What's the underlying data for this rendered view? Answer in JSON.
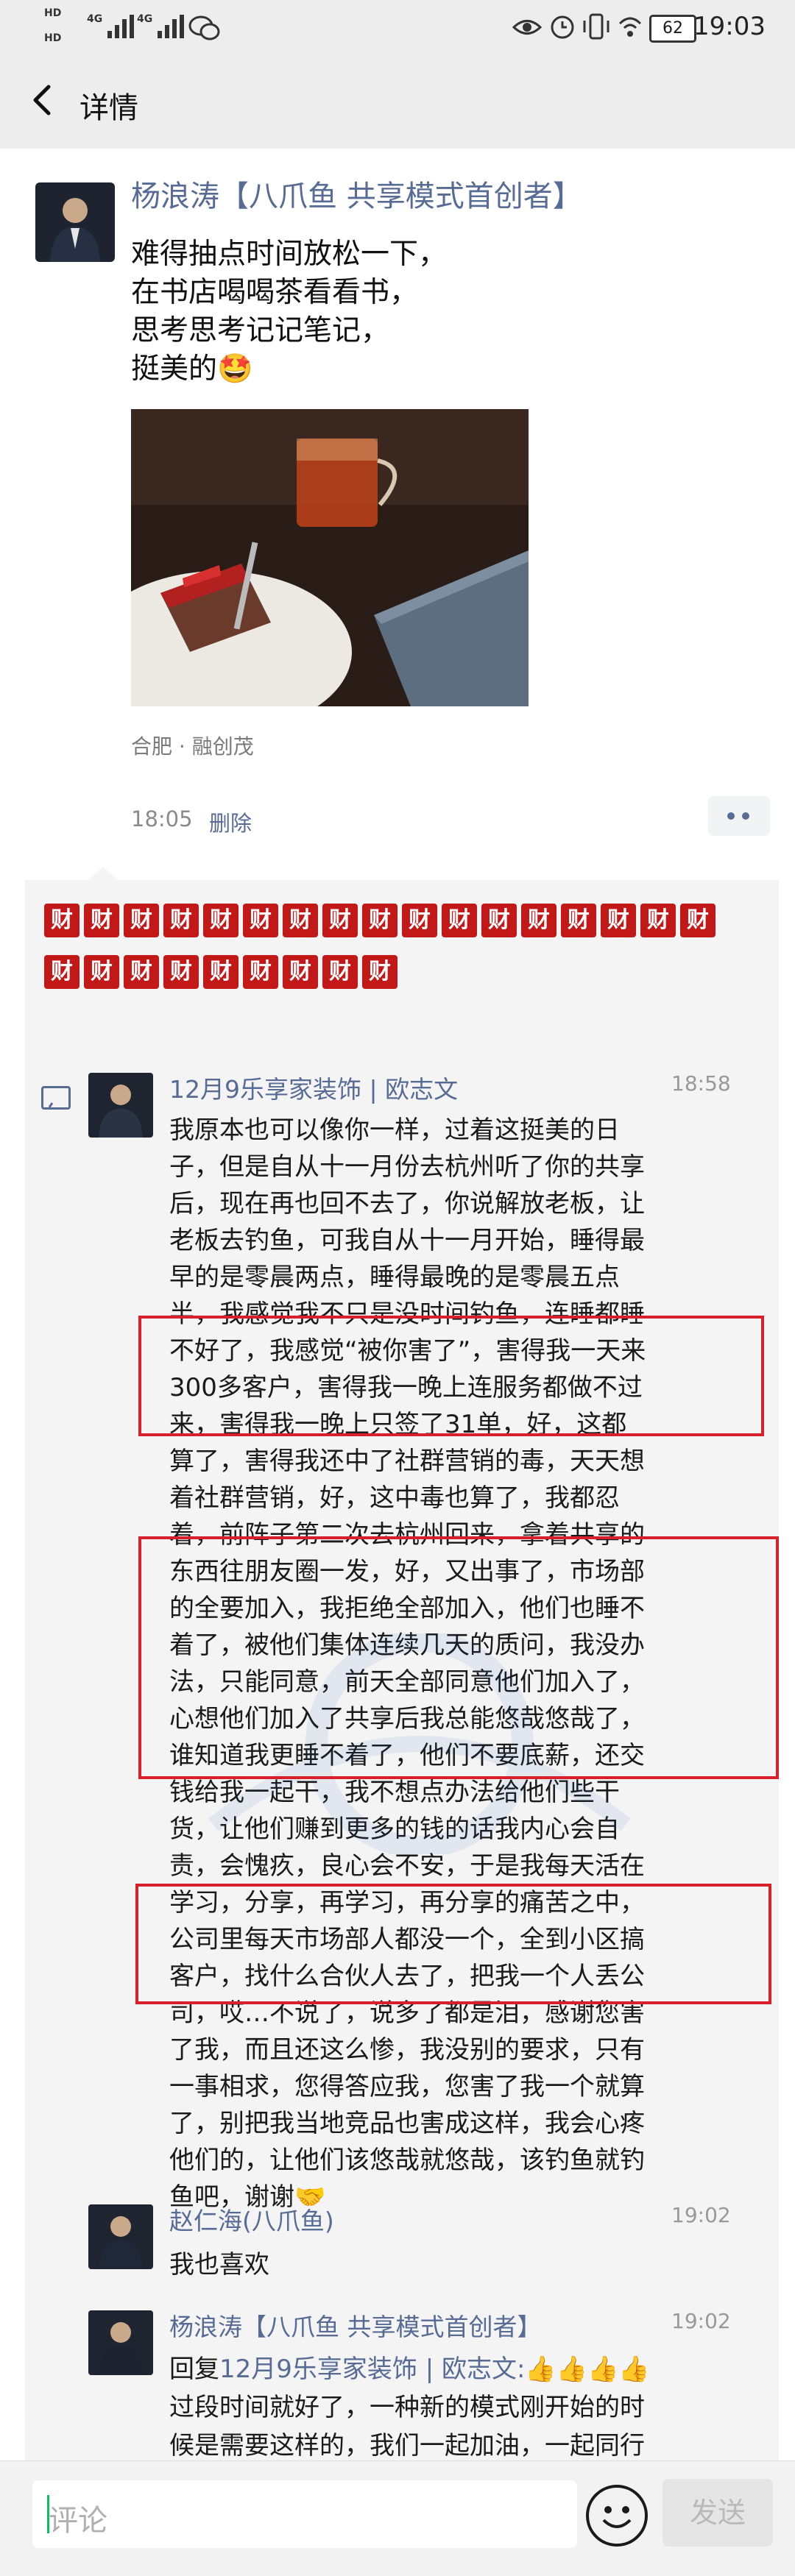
{
  "status_bar": {
    "hd1": "HD",
    "hd2": "HD",
    "sig1": "4G",
    "sig2": "4G",
    "battery": "62",
    "time": "19:03"
  },
  "header": {
    "title": "详情"
  },
  "post": {
    "author": "杨浪涛【八爪鱼 共享模式首创者】",
    "lines": [
      "难得抽点时间放松一下，",
      "在书店喝喝茶看看书，",
      "思考思考记记笔记，",
      "挺美的🤩"
    ],
    "location": "合肥 · 融创茂",
    "time": "18:05",
    "delete_label": "删除"
  },
  "likes_decoration": "财",
  "comments": [
    {
      "name": "12月9乐享家装饰 | 欧志文",
      "time": "18:58",
      "lines": [
        "我原本也可以像你一样，过着这挺美的日",
        "子，但是自从十一月份去杭州听了你的共享",
        "后，现在再也回不去了，你说解放老板，让",
        "老板去钓鱼，可我自从十一月开始，睡得最",
        "早的是零晨两点，睡得最晚的是零晨五点",
        "半，我感觉我不只是没时间钓鱼，连睡都睡",
        "不好了，我感觉“被你害了”，害得我一天来",
        "300多客户，害得我一晚上连服务都做不过",
        "来，害得我一晚上只签了31单，好，这都",
        "算了，害得我还中了社群营销的毒，天天想",
        "着社群营销，好，这中毒也算了，我都忍",
        "着，前阵子第二次去杭州回来，拿着共享的",
        "东西往朋友圈一发，好，又出事了，市场部",
        "的全要加入，我拒绝全部加入，他们也睡不",
        "着了，被他们集体连续几天的质问，我没办",
        "法，只能同意，前天全部同意他们加入了，",
        "心想他们加入了共享后我总能悠哉悠哉了，",
        "谁知道我更睡不着了，他们不要底薪，还交",
        "钱给我一起干，我不想点办法给他们些干",
        "货，让他们赚到更多的钱的话我内心会自",
        "责，会愧疚，良心会不安，于是我每天活在",
        "学习，分享，再学习，再分享的痛苦之中，",
        "公司里每天市场部人都没一个，全到小区搞",
        "客户，找什么合伙人去了，把我一个人丢公",
        "司，哎…不说了，说多了都是泪，感谢您害",
        "了我，而且还这么惨，我没别的要求，只有",
        "一事相求，您得答应我，您害了我一个就算",
        "了，别把我当地竞品也害成这样，我会心疼",
        "他们的，让他们该悠哉就悠哉，该钓鱼就钓",
        "鱼吧，谢谢🤝"
      ]
    },
    {
      "name": "赵仁海(八爪鱼)",
      "time": "19:02",
      "text": "我也喜欢"
    },
    {
      "name": "杨浪涛【八爪鱼 共享模式首创者】",
      "time": "19:02",
      "reply_prefix": "回复",
      "reply_to": "12月9乐享家装饰 | 欧志文:",
      "thumbs": "👍👍👍👍",
      "lines": [
        "过段时间就好了，一种新的模式刚开始的时",
        "候是需要这样的，我们一起加油，一起同行"
      ]
    }
  ],
  "bottom_bar": {
    "placeholder": "评论",
    "send_label": "发送"
  },
  "colors": {
    "link": "#576b95",
    "highlight_box": "#d8202a",
    "accent": "#07c160"
  }
}
